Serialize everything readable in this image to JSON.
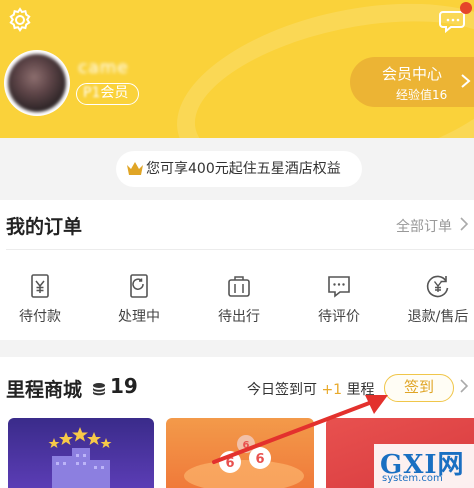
{
  "header": {
    "username": "came",
    "member_level": "会员",
    "member_level_prefix": "P1",
    "member_center": {
      "title": "会员中心",
      "subtitle": "经验值16"
    },
    "icons": [
      "gear-icon",
      "message-icon"
    ],
    "colors": {
      "background": "#fad23a",
      "pill": "#ecb434"
    }
  },
  "perk_banner": {
    "text": "您可享400元起住五星酒店权益",
    "icon": "crown-icon"
  },
  "orders": {
    "title": "我的订单",
    "all_orders": "全部订单",
    "items": [
      {
        "label": "待付款",
        "icon": "yen-clipboard-icon"
      },
      {
        "label": "处理中",
        "icon": "processing-icon"
      },
      {
        "label": "待出行",
        "icon": "luggage-icon"
      },
      {
        "label": "待评价",
        "icon": "comment-icon"
      },
      {
        "label": "退款/售后",
        "icon": "refund-icon"
      }
    ]
  },
  "mileage_mall": {
    "title": "里程商城",
    "points": "19",
    "hint_prefix": "今日签到可",
    "hint_plus": "+1",
    "hint_suffix": "里程",
    "sign_in": "签到",
    "accent": "#e8a92a"
  },
  "watermark": {
    "big": "GXI网",
    "small": "system.com"
  }
}
